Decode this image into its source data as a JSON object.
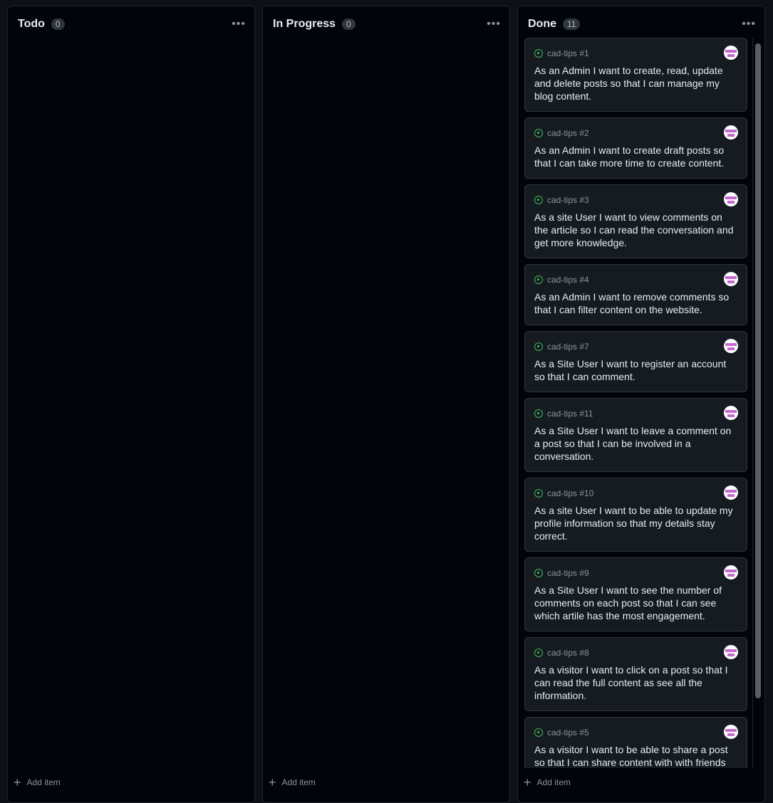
{
  "columns": [
    {
      "title": "Todo",
      "count": "0",
      "add_label": "Add item",
      "cards": []
    },
    {
      "title": "In Progress",
      "count": "0",
      "add_label": "Add item",
      "cards": []
    },
    {
      "title": "Done",
      "count": "11",
      "add_label": "Add item",
      "cards": [
        {
          "ref": "cad-tips #1",
          "title": "As an Admin I want to create, read, update and delete posts so that I can manage my blog content."
        },
        {
          "ref": "cad-tips #2",
          "title": "As an Admin I want to create draft posts so that I can take more time to create content."
        },
        {
          "ref": "cad-tips #3",
          "title": "As a site User I want to view comments on the article so I can read the conversation and get more knowledge."
        },
        {
          "ref": "cad-tips #4",
          "title": "As an Admin I want to remove comments so that I can filter content on the website."
        },
        {
          "ref": "cad-tips #7",
          "title": "As a Site User I want to register an account so that I can comment."
        },
        {
          "ref": "cad-tips #11",
          "title": "As a Site User I want to leave a comment on a post so that I can be involved in a conversation."
        },
        {
          "ref": "cad-tips #10",
          "title": "As a site User I want to be able to update my profile information so that my details stay correct."
        },
        {
          "ref": "cad-tips #9",
          "title": "As a Site User I want to see the number of comments on each post so that I can see which artile has the most engagement."
        },
        {
          "ref": "cad-tips #8",
          "title": "As a visitor I want to click on a post so that I can read the full content as see all the information."
        },
        {
          "ref": "cad-tips #5",
          "title": "As a visitor I want to be able to share a post so that I can share content with with friends"
        }
      ]
    }
  ],
  "icons": {
    "status": "issue-open-icon",
    "menu": "kebab-horizontal-icon",
    "add": "plus-icon",
    "avatar": "identicon-avatar"
  },
  "colors": {
    "issue_open": "#3fb950",
    "avatar": "#c46ad0"
  }
}
